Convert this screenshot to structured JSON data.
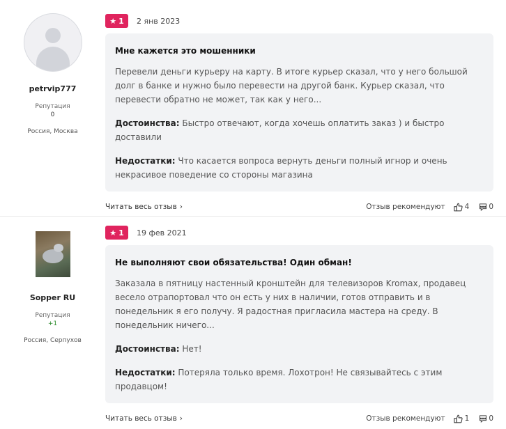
{
  "reviews": [
    {
      "author": {
        "username": "petrvip777",
        "avatar": "default-user-avatar",
        "reputation_label": "Репутация",
        "reputation_value": "0",
        "location": "Россия, Москва"
      },
      "rating": "1",
      "date": "2 янв 2023",
      "title": "Мне кажется это мошенники",
      "text": "Перевели деньги курьеру на карту. В итоге курьер сказал, что у него большой долг в банке и нужно было перевести на другой банк. Курьер сказал, что перевести обратно не может, так как у него...",
      "pros_label": "Достоинства:",
      "pros": "Быстро отвечают, когда хочешь оплатить заказ ) и быстро доставили",
      "cons_label": "Недостатки:",
      "cons": "Что касается вопроса вернуть деньги полный игнор и очень некрасивое поведение со стороны магазина",
      "read_more": "Читать весь отзыв",
      "recommend_label": "Отзыв рекомендуют",
      "likes": "4",
      "comments": "0"
    },
    {
      "author": {
        "username": "Sopper RU",
        "avatar": "cat-photo-avatar",
        "reputation_label": "Репутация",
        "reputation_value": "+1",
        "location": "Россия, Серпухов"
      },
      "rating": "1",
      "date": "19 фев 2021",
      "title": "Не выполняют свои обязательства! Один обман!",
      "text": "Заказала в пятницу настенный кронштейн для телевизоров Kromax, продавец весело отрапортовал что он есть у них в наличии, готов отправить и в понедельник я его получу. Я радостная пригласила мастера на среду. В понедельник ничего...",
      "pros_label": "Достоинства:",
      "pros": "Нет!",
      "cons_label": "Недостатки:",
      "cons": "Потеряла только время. Лохотрон! Не связывайтесь с этим продавцом!",
      "read_more": "Читать весь отзыв",
      "recommend_label": "Отзыв рекомендуют",
      "likes": "1",
      "comments": "0"
    }
  ],
  "colors": {
    "rating_badge": "#e0245e",
    "card_background": "#f2f3f5",
    "positive_reputation": "#2a8a2a"
  }
}
